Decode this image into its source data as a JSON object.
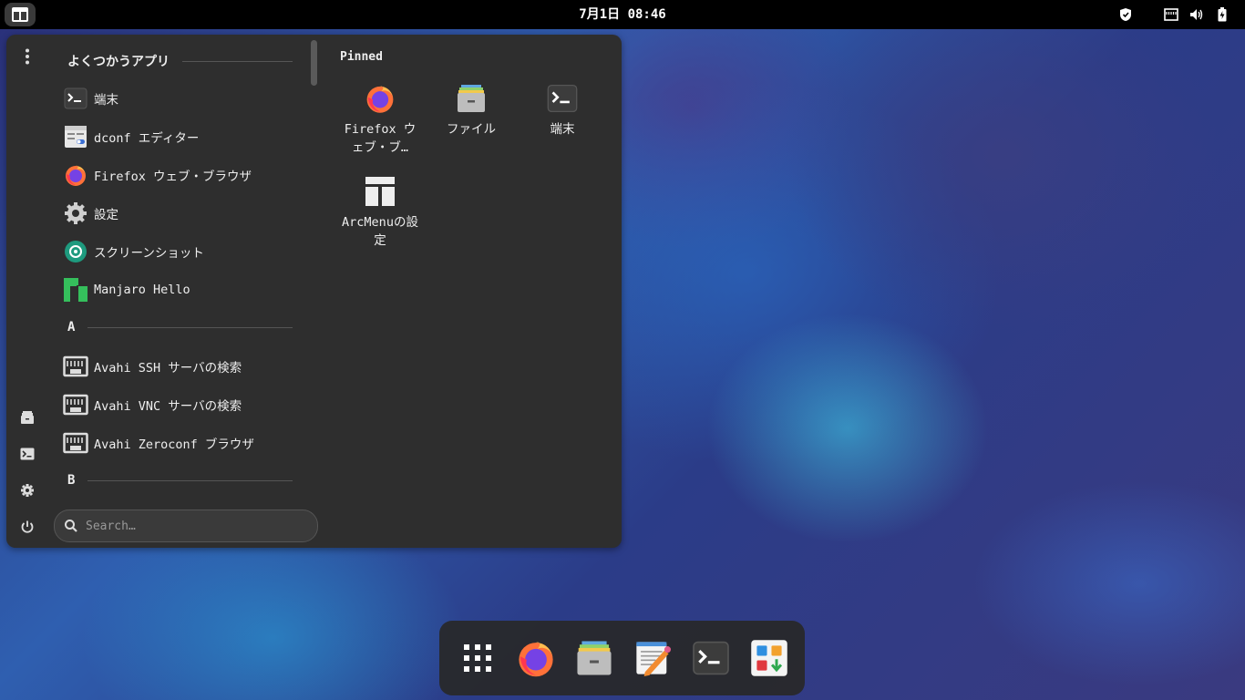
{
  "panel": {
    "clock": "7月1日 08:46",
    "tray_icons": [
      "shield-icon",
      "network-icon",
      "volume-icon",
      "battery-icon"
    ]
  },
  "menu": {
    "frequent_header": "よくつかうアプリ",
    "frequent_apps": [
      {
        "label": "端末",
        "icon": "terminal-icon"
      },
      {
        "label": "dconf エディター",
        "icon": "dconf-icon"
      },
      {
        "label": "Firefox ウェブ・ブラウザ",
        "icon": "firefox-icon"
      },
      {
        "label": "設定",
        "icon": "settings-icon"
      },
      {
        "label": "スクリーンショット",
        "icon": "screenshot-icon"
      },
      {
        "label": "Manjaro Hello",
        "icon": "manjaro-icon"
      }
    ],
    "section_a": "A",
    "a_apps": [
      {
        "label": "Avahi SSH サーバの検索",
        "icon": "network-icon"
      },
      {
        "label": "Avahi VNC サーバの検索",
        "icon": "network-icon"
      },
      {
        "label": "Avahi Zeroconf ブラウザ",
        "icon": "network-icon"
      }
    ],
    "section_b": "B",
    "pinned_title": "Pinned",
    "pinned": [
      {
        "label": "Firefox ウェブ・ブ…",
        "icon": "firefox-icon"
      },
      {
        "label": "ファイル",
        "icon": "files-icon"
      },
      {
        "label": "端末",
        "icon": "terminal-icon"
      },
      {
        "label": "ArcMenuの設定",
        "icon": "arcmenu-icon"
      }
    ],
    "search_placeholder": "Search…"
  },
  "dock": {
    "items": [
      "app-grid-icon",
      "firefox-icon",
      "files-icon",
      "text-editor-icon",
      "terminal-icon",
      "software-icon"
    ]
  }
}
